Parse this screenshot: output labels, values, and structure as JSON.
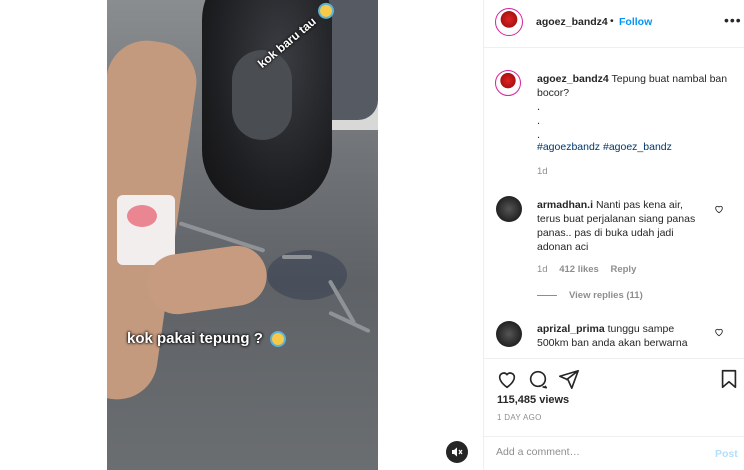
{
  "post": {
    "username": "agoez_bandz4",
    "dot": "•",
    "follow_label": "Follow",
    "more_label": "•••"
  },
  "video": {
    "overlay_top": "kok baru tau",
    "overlay_middle": "kok pakai tepung ?",
    "mute_icon": "speaker-muted-icon"
  },
  "caption": {
    "username": "agoez_bandz4",
    "text": "Tepung buat nambal ban bocor?",
    "dots": [
      ".",
      ".",
      "."
    ],
    "hashtags": "#agoezbandz #agoez_bandz",
    "time": "1d"
  },
  "comments": [
    {
      "username": "armadhan.i",
      "text": "Nanti pas kena air, terus buat perjalanan siang panas panas.. pas di buka udah jadi adonan aci",
      "time": "1d",
      "likes": "412 likes",
      "reply_label": "Reply",
      "view_replies": "View replies (11)"
    },
    {
      "username": "aprizal_prima",
      "text": "tunggu sampe 500km ban anda akan berwarna"
    }
  ],
  "actions": {
    "like_icon": "heart-icon",
    "comment_icon": "comment-icon",
    "share_icon": "share-icon",
    "save_icon": "bookmark-icon",
    "views": "115,485 views",
    "ago": "1 DAY AGO"
  },
  "add_comment": {
    "placeholder": "Add a comment…",
    "post_label": "Post"
  },
  "colors": {
    "accent": "#0095f6",
    "hashtag": "#00376b",
    "muted": "#8e8e8e",
    "post_disabled": "#b2dffc"
  }
}
